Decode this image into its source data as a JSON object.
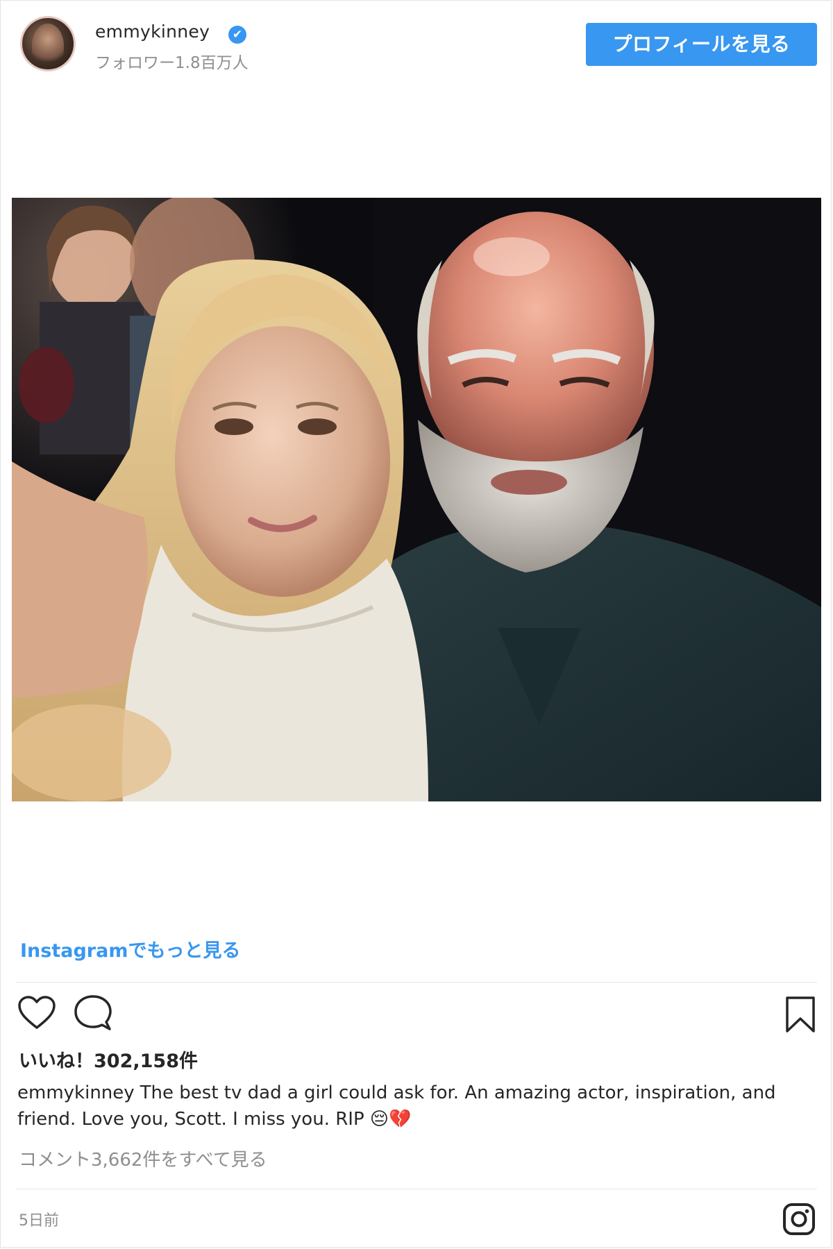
{
  "header": {
    "username": "emmykinney",
    "verified_mark": "✔",
    "followers": "フォロワー1.8百万人",
    "profile_button": "プロフィールを見る"
  },
  "more_link": "Instagramでもっと見る",
  "actions": {
    "like_icon": "heart-icon",
    "comment_icon": "comment-icon",
    "save_icon": "bookmark-icon"
  },
  "likes": "いいね！302,158件",
  "caption": {
    "user": "emmykinney",
    "text": "The best tv dad a girl could ask for. An amazing actor, inspiration, and friend. Love you, Scott. I miss you. RIP 😔💔"
  },
  "comments_link": "コメント3,662件をすべて見る",
  "timestamp": "5日前",
  "footer_icon": "instagram-icon",
  "colors": {
    "accent": "#3897f0",
    "muted": "#8e8e8e",
    "text": "#262626"
  }
}
